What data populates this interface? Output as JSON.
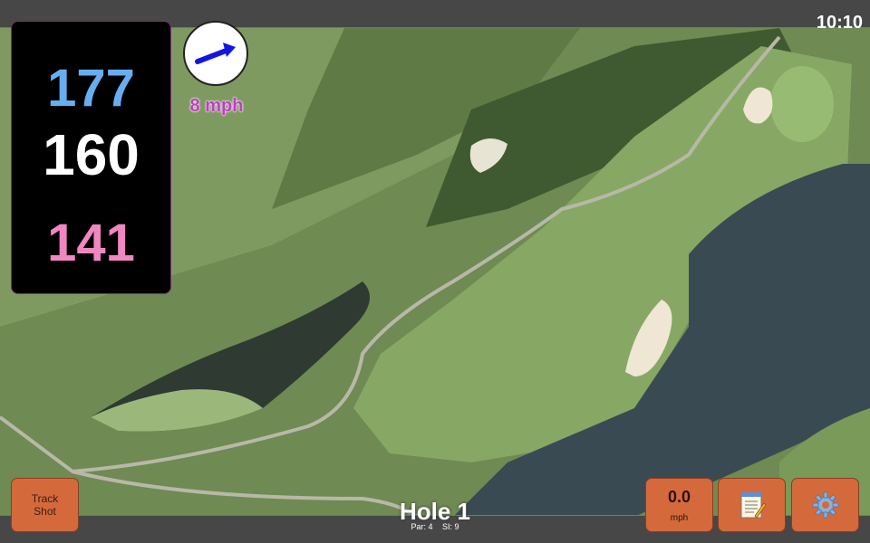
{
  "status_bar": {
    "time": "10:10"
  },
  "distances": {
    "back": "177",
    "middle": "160",
    "front": "141"
  },
  "wind": {
    "speed": "8 mph",
    "direction_icon": "arrow-right-up-icon"
  },
  "hole": {
    "title": "Hole 1",
    "par": "Par: 4",
    "stroke_index": "SI: 9"
  },
  "buttons": {
    "track_shot": "Track Shot",
    "speed_value": "0.0",
    "speed_unit": "mph",
    "notes_icon": "notepad-icon",
    "settings_icon": "gear-icon"
  },
  "colors": {
    "back": "#67aef0",
    "middle": "#ffffff",
    "front": "#f087c0",
    "wind_text": "#c23bc9",
    "button": "#d46a3c",
    "bar": "#474747"
  }
}
